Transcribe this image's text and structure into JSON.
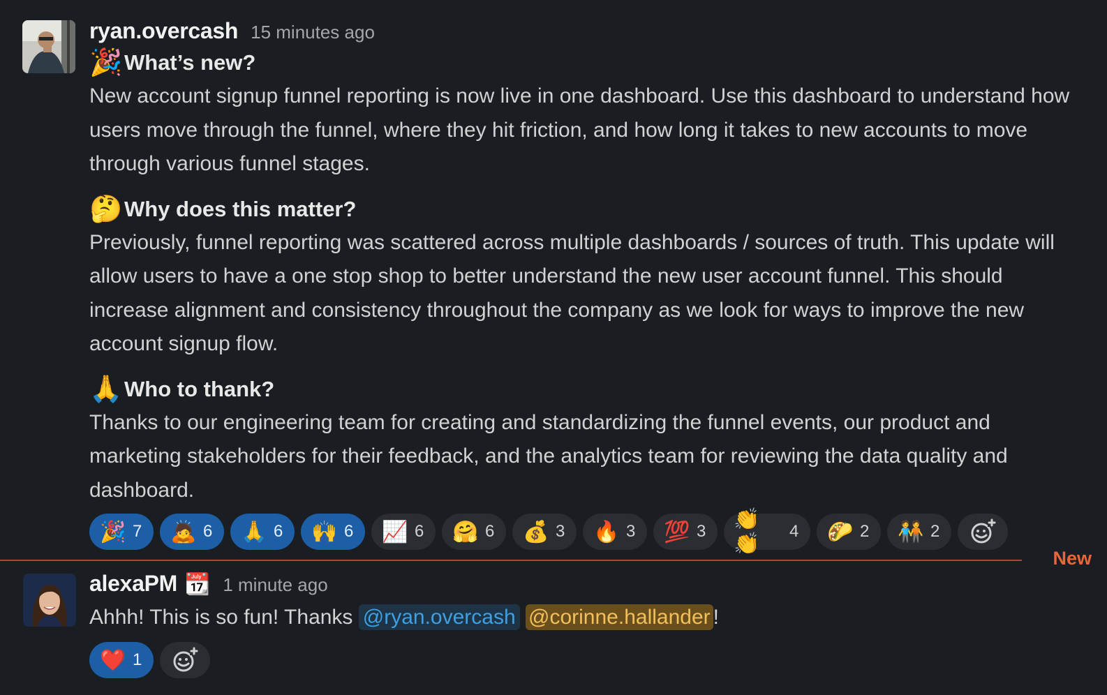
{
  "messages": [
    {
      "author": "ryan.overcash",
      "time": "15 minutes ago",
      "sections": [
        {
          "emoji": "🎉",
          "heading": "What’s new?",
          "body": "New account signup funnel reporting is now live in one dashboard.  Use this dashboard to understand how users move through the funnel, where they hit friction, and how long it takes to new accounts to move through various funnel stages."
        },
        {
          "emoji": "🤔",
          "heading": "Why does this matter?",
          "body": "Previously, funnel reporting was scattered across multiple dashboards / sources of truth.  This update will allow users to have a one stop shop to better understand the new user account funnel. This should increase alignment and consistency throughout the company as we look for ways to improve the new account signup flow."
        },
        {
          "emoji": "🙏",
          "heading": "Who to thank?",
          "body": "Thanks to our engineering team for creating and standardizing the funnel events, our product and marketing stakeholders for their feedback, and the analytics team for reviewing the data quality and dashboard."
        }
      ],
      "reactions": [
        {
          "emoji": "🎉",
          "count": "7",
          "active": true
        },
        {
          "emoji": "🙇",
          "count": "6",
          "active": true
        },
        {
          "emoji": "🙏",
          "count": "6",
          "active": true,
          "icon": "thank-you-icon"
        },
        {
          "emoji": "🙌",
          "count": "6",
          "active": true
        },
        {
          "emoji": "📈",
          "count": "6",
          "active": false
        },
        {
          "emoji": "🤗",
          "count": "6",
          "active": false
        },
        {
          "emoji": "💰",
          "count": "3",
          "active": false
        },
        {
          "emoji": "🔥",
          "count": "3",
          "active": false
        },
        {
          "emoji": "💯",
          "count": "3",
          "active": false
        },
        {
          "emoji": "👏👏",
          "count": "4",
          "active": false
        },
        {
          "emoji": "🌮",
          "count": "2",
          "active": false
        },
        {
          "emoji": "🧑‍🤝‍🧑",
          "count": "2",
          "active": false
        }
      ]
    }
  ],
  "divider": {
    "label": "New"
  },
  "reply": {
    "author": "alexaPM",
    "status_emoji": "📆",
    "time": "1 minute ago",
    "text_before": "Ahhh! This is so fun! Thanks ",
    "mention1": "@ryan.overcash",
    "mention2": "@corinne.hallander",
    "text_after": "!",
    "reactions": [
      {
        "emoji": "❤️",
        "count": "1",
        "active": true
      }
    ]
  }
}
